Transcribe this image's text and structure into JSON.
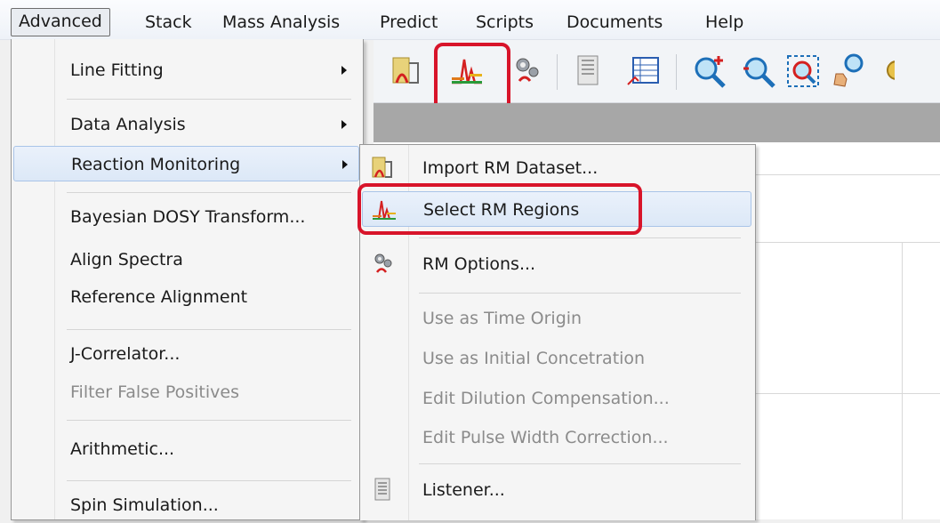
{
  "menubar": {
    "items": [
      "Advanced",
      "Stack",
      "Mass Analysis",
      "Predict",
      "Scripts",
      "Documents",
      "Help"
    ]
  },
  "toolbar": {
    "buttons": [
      {
        "icon": "import-rm-icon"
      },
      {
        "icon": "select-rm-regions-icon",
        "highlighted": true
      },
      {
        "icon": "rm-options-icon"
      },
      {
        "icon": "listener-icon"
      },
      {
        "icon": "table-chart-icon"
      },
      {
        "icon": "zoom-in-icon"
      },
      {
        "icon": "zoom-out-icon"
      },
      {
        "icon": "zoom-fit-icon"
      },
      {
        "icon": "hand-zoom-icon"
      }
    ],
    "highlight_color": "#d8142a"
  },
  "menu": {
    "items": [
      {
        "label": "Line Fitting",
        "submenu": true
      },
      {
        "label": "Data Analysis",
        "submenu": true
      },
      {
        "label": "Reaction Monitoring",
        "submenu": true,
        "hover": true
      },
      {
        "label": "Bayesian DOSY Transform..."
      },
      {
        "label": "Align Spectra"
      },
      {
        "label": "Reference Alignment"
      },
      {
        "label": "J-Correlator..."
      },
      {
        "label": "Filter False Positives",
        "disabled": true
      },
      {
        "label": "Arithmetic..."
      },
      {
        "label": "Spin Simulation..."
      }
    ]
  },
  "submenu": {
    "items": [
      {
        "label": "Import RM Dataset...",
        "icon": "import-rm-icon"
      },
      {
        "label": "Select RM Regions",
        "icon": "select-rm-regions-icon",
        "hover": true
      },
      {
        "label": "RM Options...",
        "icon": "rm-options-icon"
      },
      {
        "label": "Use as Time Origin",
        "disabled": true
      },
      {
        "label": "Use as Initial Concetration",
        "disabled": true
      },
      {
        "label": "Edit Dilution Compensation...",
        "disabled": true
      },
      {
        "label": "Edit Pulse Width Correction...",
        "disabled": true
      },
      {
        "label": "Listener...",
        "icon": "listener-icon"
      }
    ]
  },
  "colors": {
    "accent_highlight": "#d8142a",
    "hover_blue": "#dce8f7",
    "disabled_text": "#8b8b8b"
  }
}
